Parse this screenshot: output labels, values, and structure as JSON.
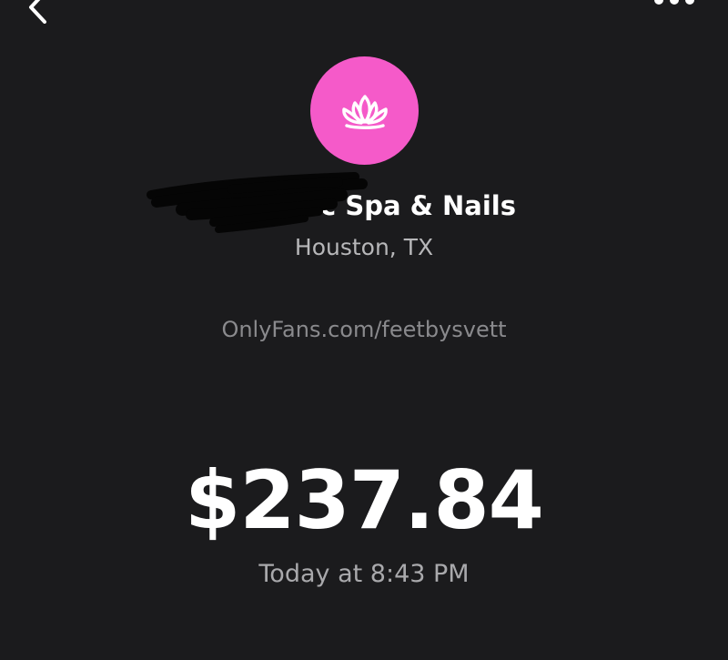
{
  "header": {
    "back_icon": "chevron-left-icon",
    "more_icon": "more-horizontal-icon"
  },
  "merchant": {
    "avatar_icon": "lotus-icon",
    "avatar_color": "#f55ac9",
    "name_visible": "c Spa & Nails",
    "location": "Houston, TX"
  },
  "payment": {
    "note": "OnlyFans.com/feetbysvett",
    "amount": "$237.84",
    "timestamp": "Today at 8:43 PM"
  },
  "colors": {
    "background": "#1b1b1d",
    "primary_text": "#ffffff",
    "secondary_text": "#b7b7b9",
    "muted_text": "#8a8a8d"
  }
}
